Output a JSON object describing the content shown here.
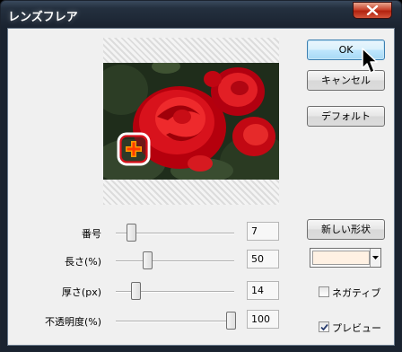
{
  "window": {
    "title": "レンズフレア"
  },
  "buttons": {
    "ok": "OK",
    "cancel": "キャンセル",
    "default": "デフォルト",
    "new_shape": "新しい形状"
  },
  "sliders": [
    {
      "label": "番号",
      "value": "7",
      "level": 0.12
    },
    {
      "label": "長さ(%)",
      "value": "50",
      "level": 0.25
    },
    {
      "label": "厚さ(px)",
      "value": "14",
      "level": 0.16
    },
    {
      "label": "不透明度(%)",
      "value": "100",
      "level": 1.0
    }
  ],
  "color": {
    "selected": "#fff1e3"
  },
  "options": {
    "negative": {
      "label": "ネガティブ",
      "checked": false
    },
    "preview": {
      "label": "プレビュー",
      "checked": true
    }
  },
  "icons": [
    "close-icon",
    "flare-center-icon",
    "dropdown-arrow-icon",
    "checkmark-icon",
    "mouse-pointer-icon"
  ]
}
